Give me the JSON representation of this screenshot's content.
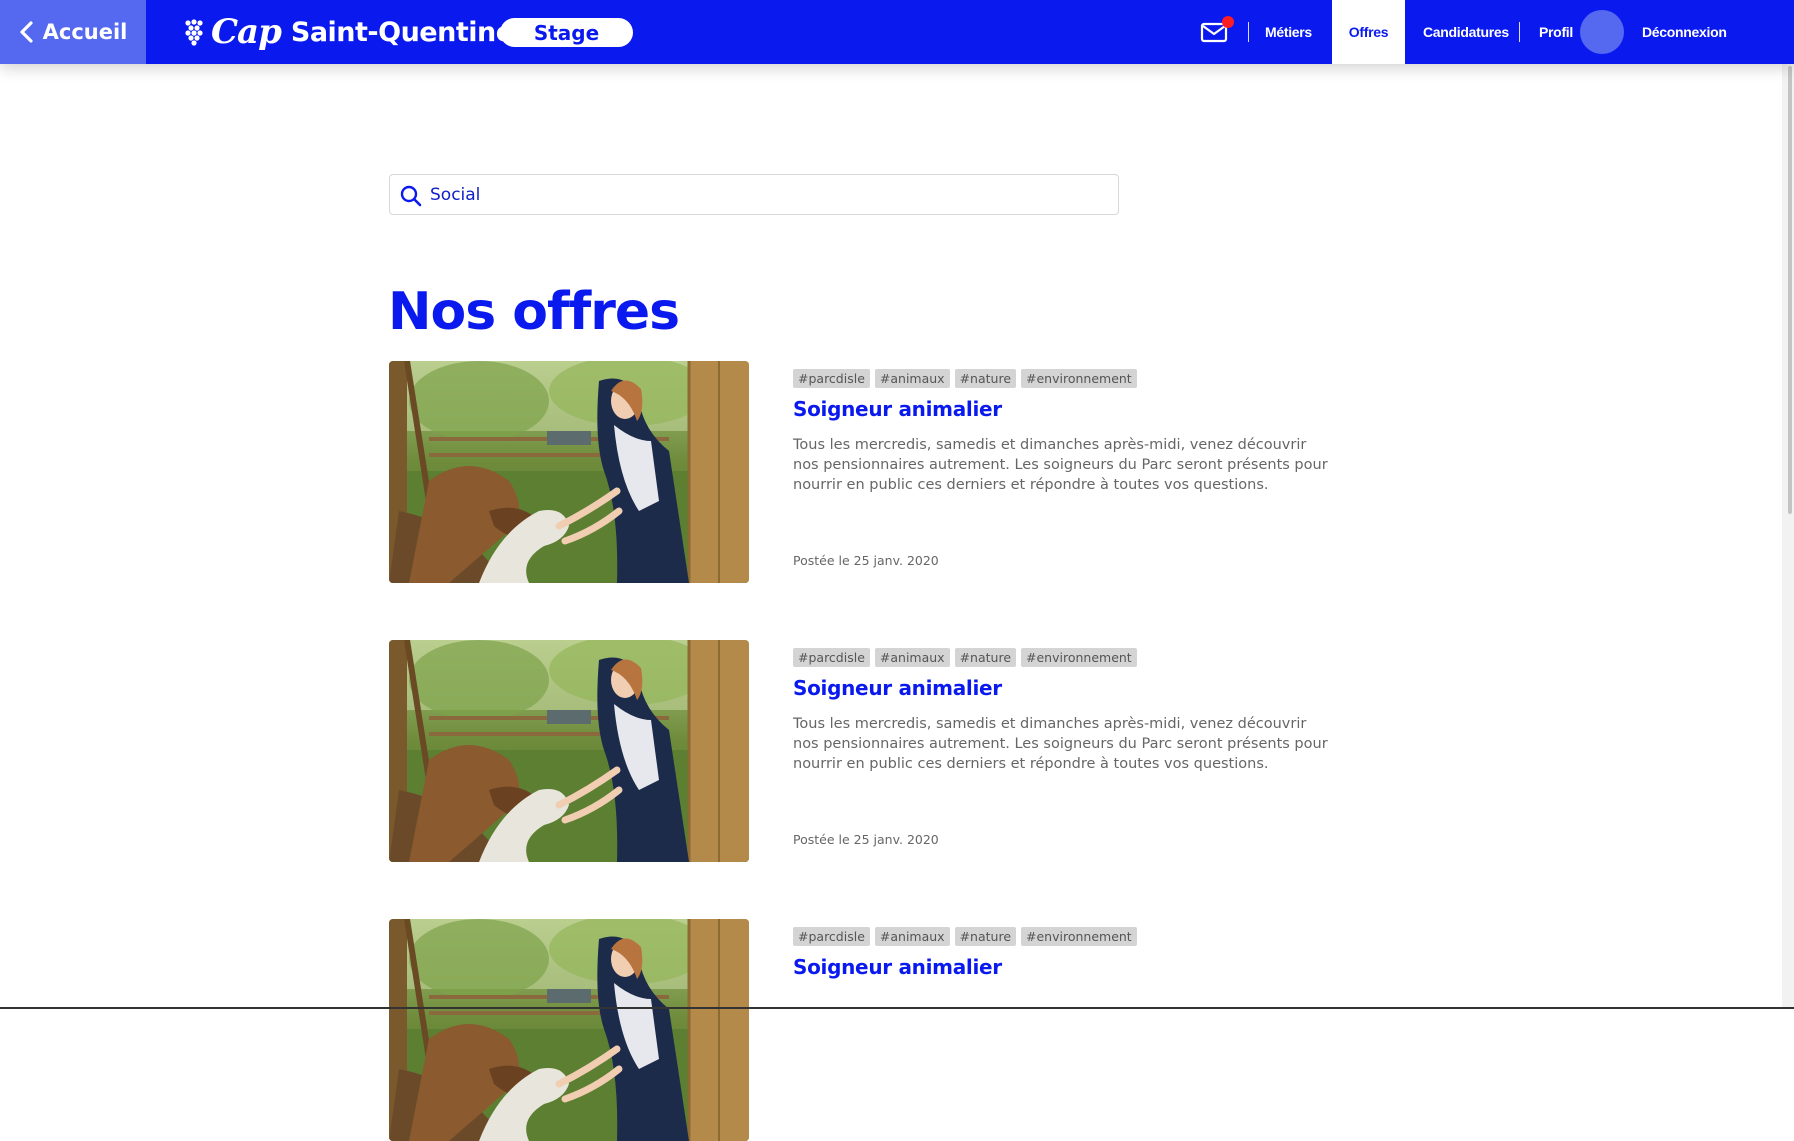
{
  "header": {
    "back_label": "Accueil",
    "logo_cap": "Cap",
    "logo_city": "Saint-Quentinois",
    "stage_label": "Stage",
    "nav": {
      "metiers": "Métiers",
      "offres": "Offres",
      "candidatures": "Candidatures",
      "profil": "Profil",
      "deconnexion": "Déconnexion"
    },
    "mail_has_notification": true
  },
  "search": {
    "value": "Social"
  },
  "page_title": "Nos offres",
  "offers": [
    {
      "tags": [
        "#parcdisle",
        "#animaux",
        "#nature",
        "#environnement"
      ],
      "title": "Soigneur animalier",
      "description": "Tous les mercredis, samedis et dimanches après-midi, venez découvrir nos pensionnaires autrement. Les soigneurs du Parc seront présents pour nourrir en public ces derniers et répondre à toutes vos questions.",
      "date": "Postée le 25 janv. 2020"
    },
    {
      "tags": [
        "#parcdisle",
        "#animaux",
        "#nature",
        "#environnement"
      ],
      "title": "Soigneur animalier",
      "description": "Tous les mercredis, samedis et dimanches après-midi, venez découvrir nos pensionnaires autrement. Les soigneurs du Parc seront présents pour nourrir en public ces derniers et répondre à toutes vos questions.",
      "date": "Postée le 25 janv. 2020"
    },
    {
      "tags": [
        "#parcdisle",
        "#animaux",
        "#nature",
        "#environnement"
      ],
      "title": "Soigneur animalier"
    }
  ],
  "colors": {
    "brand_blue": "#0a1aef",
    "light_blue": "#5468f0",
    "notification_red": "#ff1d25"
  }
}
